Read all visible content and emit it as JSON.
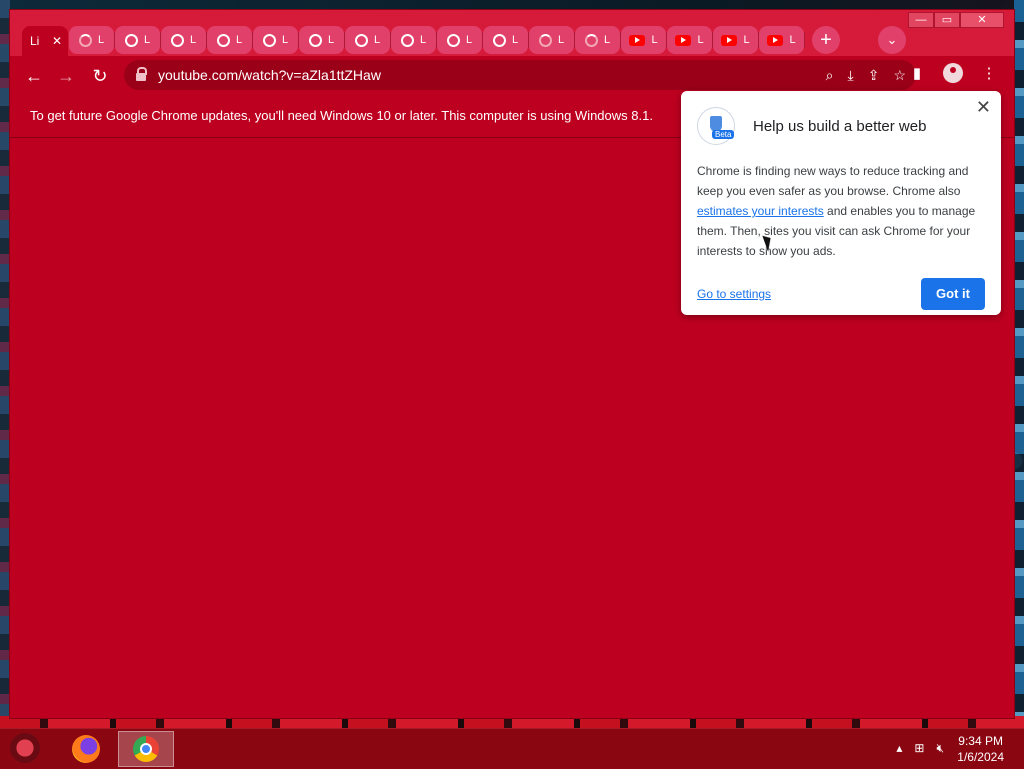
{
  "browser": {
    "active_tab": {
      "title_abbrev": "Li",
      "close": "✕"
    },
    "mini_tabs": [
      {
        "icon": "loading",
        "letter": "L"
      },
      {
        "icon": "youtube-outline",
        "letter": "L"
      },
      {
        "icon": "circle",
        "letter": "L"
      },
      {
        "icon": "circle",
        "letter": "L"
      },
      {
        "icon": "circle",
        "letter": "L"
      },
      {
        "icon": "circle",
        "letter": "L"
      },
      {
        "icon": "circle",
        "letter": "L"
      },
      {
        "icon": "circle",
        "letter": "L"
      },
      {
        "icon": "youtube-outline",
        "letter": "L"
      },
      {
        "icon": "circle",
        "letter": "L"
      },
      {
        "icon": "loading",
        "letter": "L"
      },
      {
        "icon": "loading",
        "letter": "L"
      },
      {
        "icon": "youtube",
        "letter": "L"
      },
      {
        "icon": "youtube",
        "letter": "L"
      },
      {
        "icon": "youtube",
        "letter": "L"
      },
      {
        "icon": "youtube",
        "letter": "L"
      }
    ],
    "new_tab": "+",
    "url": "youtube.com/watch?v=aZla1ttZHaw",
    "window_controls": {
      "min": "—",
      "max": "▭",
      "close": "✕"
    }
  },
  "infobar": {
    "message": "To get future Google Chrome updates, you'll need Windows 10 or later. This computer is using Windows 8.1."
  },
  "popup": {
    "badge": "Beta",
    "title": "Help us build a better web",
    "body_before": "Chrome is finding new ways to reduce tracking and keep you even safer as you browse. Chrome also ",
    "body_link": "estimates your interests",
    "body_after": " and enables you to manage them. Then, sites you visit can ask Chrome for your interests to show you ads.",
    "settings_link": "Go to settings",
    "got_it": "Got it"
  },
  "taskbar": {
    "time": "9:34 PM",
    "date": "1/6/2024"
  },
  "colors": {
    "theme_red": "#be0020",
    "link_blue": "#1a73e8"
  }
}
